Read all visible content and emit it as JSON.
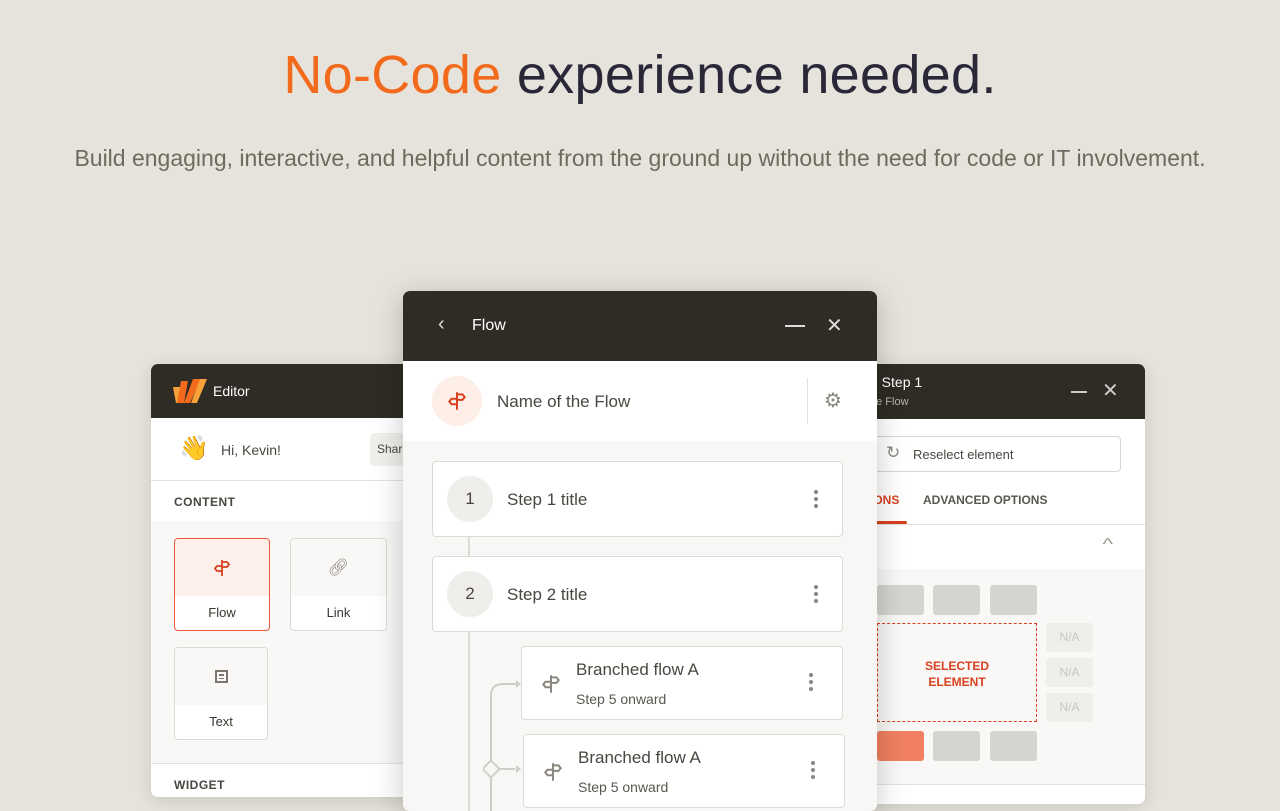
{
  "hero": {
    "title_accent": "No-Code",
    "title_rest": " experience needed.",
    "subtitle": "Build engaging, interactive, and helpful content from the ground up without the need for code or IT involvement."
  },
  "colors": {
    "accent": "#f26b1d",
    "brand_red": "#d9401f",
    "header_bg": "#2f2b25",
    "background": "#e6e3dc"
  },
  "editor": {
    "title": "Editor",
    "greeting": "Hi, Kevin!",
    "share_partial": "Shar",
    "content_label": "CONTENT",
    "items": [
      {
        "label": "Flow",
        "icon": "signpost-icon",
        "selected": true
      },
      {
        "label": "Link",
        "icon": "link-icon"
      },
      {
        "label": "Text",
        "icon": "text-icon"
      }
    ],
    "widget_label": "WIDGET"
  },
  "flow": {
    "title": "Flow",
    "name": "Name of the Flow",
    "steps": [
      {
        "num": "1",
        "title": "Step 1 title"
      },
      {
        "num": "2",
        "title": "Step 2 title"
      }
    ],
    "branches": [
      {
        "title": "Branched flow A",
        "sub": "Step 5 onward"
      },
      {
        "title": "Branched flow A",
        "sub": "Step 5 onward"
      }
    ]
  },
  "step_panel": {
    "title_partial": "g Step 1",
    "subtitle_partial": "he Flow",
    "reselect": "Reselect element",
    "tab_active_partial": "IONS",
    "tab_advanced": "ADVANCED OPTIONS",
    "selected_element": "SELECTED ELEMENT",
    "na": [
      "N/A",
      "N/A",
      "N/A"
    ]
  }
}
